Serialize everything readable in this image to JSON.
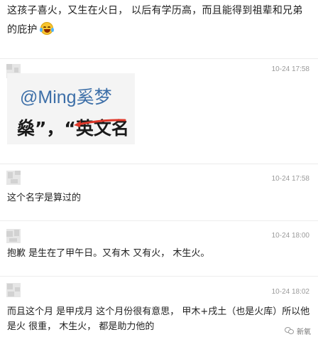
{
  "intro": {
    "text": "这孩子喜火，又生在火日， 以后有学历高，而且能得到祖辈和兄弟的庇护",
    "emoji_icon": "laughing-crying-icon"
  },
  "embedded_image": {
    "line1": "@Ming奚梦",
    "line2": "燊”，“英文名"
  },
  "comments": [
    {
      "timestamp": "10-24 17:58",
      "text": ""
    },
    {
      "timestamp": "10-24 17:58",
      "text": "这个名字是算过的"
    },
    {
      "timestamp": "10-24 18:00",
      "text": "抱歉 是生在了甲午日。又有木 又有火， 木生火。"
    },
    {
      "timestamp": "10-24 18:02",
      "text": "而且这个月 是甲戌月 这个月份很有意思， 甲木+戌土（也是火库）所以他是火 很重， 木生火， 都是助力他的"
    }
  ],
  "watermark": {
    "text": "新氧",
    "icon": "wechat-icon"
  },
  "colors": {
    "timestamp": "#9a9a9a",
    "divider": "#ececec",
    "arrow": "#e0392b",
    "link_blue": "#3d6fa8"
  }
}
